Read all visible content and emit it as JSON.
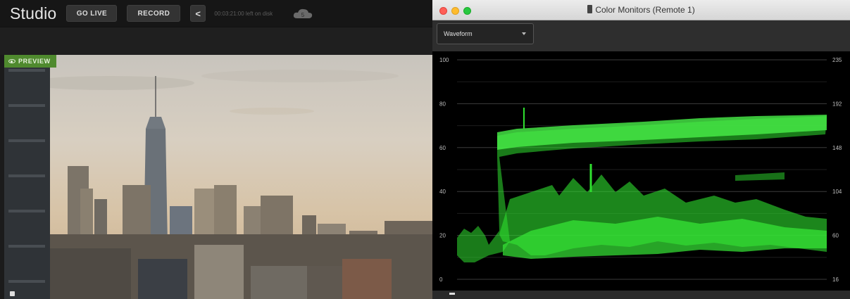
{
  "studio": {
    "title": "Studio",
    "go_live_label": "GO LIVE",
    "record_label": "RECORD",
    "share_glyph": "<",
    "disk_status": "00:03:21:00 left on disk",
    "cloud_badge": "5",
    "preview_badge": "PREVIEW"
  },
  "monitors": {
    "window_title": "Color Monitors (Remote 1)",
    "scope_mode": "Waveform",
    "left_scale": [
      "100",
      "80",
      "60",
      "40",
      "20",
      "0"
    ],
    "right_scale": [
      "235",
      "192",
      "148",
      "104",
      "60",
      "16"
    ],
    "trace_color": "#2fe02f"
  },
  "colors": {
    "preview_green": "#4f8a2e",
    "scope_green": "#2fe02f"
  },
  "icons": {
    "share": "share-icon",
    "cloud": "cloud-icon",
    "eye": "eye-icon",
    "dropdown": "chevron-down-icon"
  }
}
